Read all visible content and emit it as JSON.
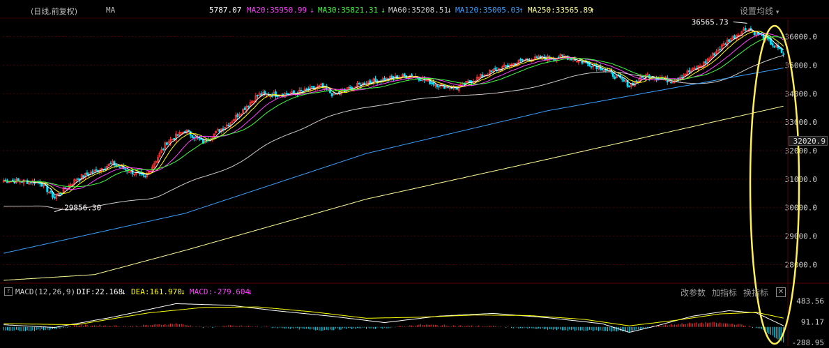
{
  "header": {
    "period_label": "(日线,前复权)",
    "ma_label": "MA",
    "ma5": "5787.07",
    "ma20": "MA20:35950.99",
    "ma30": "MA30:35821.31",
    "ma60": "MA60:35208.51",
    "ma120": "MA120:35005.03",
    "ma250": "MA250:33565.89",
    "settings_label": "设置均线",
    "arrow_down": "↓",
    "arrow_up": "↑"
  },
  "macd_header": {
    "title": "MACD(12,26,9)",
    "dif": "DIF:22.168",
    "dea": "DEA:161.970",
    "macd": "MACD:-279.604",
    "arrow_down": "↓",
    "change_params": "改参数",
    "add_indicator": "加指标",
    "switch_indicator": "换指标",
    "close": "✕",
    "help": "?"
  },
  "current_price_box": "32020.9",
  "colors": {
    "up": "#ff3333",
    "down": "#00e5ff",
    "ma5": "#ffffff",
    "ma10": "#ffff00",
    "ma20": "#ff40ff",
    "ma30": "#40ff40",
    "ma60": "#cccccc",
    "ma120": "#3aa0ff",
    "ma250": "#ffff99",
    "annotation": "#ffee55",
    "grid": "#4a0000",
    "axis_text": "#cccccc"
  },
  "chart_data": [
    {
      "type": "candlestick",
      "title": "",
      "ylim": [
        27400,
        36600
      ],
      "y_ticks": [
        "36000.0",
        "35000.0",
        "34000.0",
        "33000.0",
        "32000.0",
        "31000.0",
        "30000.0",
        "29000.0",
        "28000.0"
      ],
      "tick_values": [
        36000,
        35000,
        34000,
        33000,
        32000,
        31000,
        30000,
        29000,
        28000
      ],
      "annotations": [
        {
          "text": "29856.30",
          "value": 29856.3
        },
        {
          "text": "36565.73",
          "value": 36565.73
        }
      ],
      "close_keypoints": [
        [
          0,
          30950
        ],
        [
          20,
          30900
        ],
        [
          28,
          30350
        ],
        [
          40,
          31000
        ],
        [
          60,
          31550
        ],
        [
          78,
          31050
        ],
        [
          90,
          32300
        ],
        [
          100,
          32700
        ],
        [
          110,
          32300
        ],
        [
          125,
          33000
        ],
        [
          140,
          33950
        ],
        [
          160,
          34000
        ],
        [
          175,
          34250
        ],
        [
          182,
          33950
        ],
        [
          200,
          34400
        ],
        [
          225,
          34650
        ],
        [
          240,
          34300
        ],
        [
          250,
          34200
        ],
        [
          268,
          34750
        ],
        [
          288,
          35200
        ],
        [
          310,
          35300
        ],
        [
          330,
          34900
        ],
        [
          345,
          34300
        ],
        [
          355,
          34650
        ],
        [
          368,
          34450
        ],
        [
          385,
          35000
        ],
        [
          400,
          35900
        ],
        [
          410,
          36300
        ],
        [
          420,
          35950
        ],
        [
          430,
          35400
        ]
      ],
      "ma120_keypoints": [
        [
          0,
          28400
        ],
        [
          100,
          29800
        ],
        [
          200,
          31900
        ],
        [
          300,
          33400
        ],
        [
          430,
          34900
        ]
      ],
      "ma250_keypoints": [
        [
          0,
          27450
        ],
        [
          50,
          27650
        ],
        [
          100,
          28500
        ],
        [
          200,
          30300
        ],
        [
          300,
          31700
        ],
        [
          430,
          33560
        ]
      ]
    },
    {
      "type": "bar",
      "title": "",
      "ylim": [
        -300,
        500
      ],
      "y_ticks": [
        "483.56",
        "91.17",
        "-288.95"
      ],
      "tick_values": [
        483.56,
        91.17,
        -288.95
      ],
      "macd_keypoints": [
        [
          0,
          -60
        ],
        [
          15,
          -70
        ],
        [
          28,
          -40
        ],
        [
          40,
          30
        ],
        [
          55,
          25
        ],
        [
          70,
          10
        ],
        [
          85,
          40
        ],
        [
          95,
          60
        ],
        [
          110,
          -10
        ],
        [
          125,
          20
        ],
        [
          140,
          5
        ],
        [
          155,
          -20
        ],
        [
          175,
          -60
        ],
        [
          190,
          -30
        ],
        [
          210,
          -20
        ],
        [
          230,
          40
        ],
        [
          250,
          20
        ],
        [
          270,
          10
        ],
        [
          290,
          -30
        ],
        [
          310,
          -60
        ],
        [
          330,
          -70
        ],
        [
          345,
          -90
        ],
        [
          360,
          20
        ],
        [
          375,
          60
        ],
        [
          390,
          80
        ],
        [
          405,
          50
        ],
        [
          418,
          -40
        ],
        [
          430,
          -280
        ]
      ],
      "dif_keypoints": [
        [
          0,
          40
        ],
        [
          28,
          -10
        ],
        [
          60,
          180
        ],
        [
          95,
          430
        ],
        [
          125,
          400
        ],
        [
          150,
          300
        ],
        [
          180,
          200
        ],
        [
          210,
          80
        ],
        [
          240,
          200
        ],
        [
          270,
          250
        ],
        [
          300,
          170
        ],
        [
          330,
          60
        ],
        [
          345,
          -100
        ],
        [
          360,
          20
        ],
        [
          380,
          200
        ],
        [
          400,
          300
        ],
        [
          415,
          260
        ],
        [
          430,
          22
        ]
      ],
      "dea_keypoints": [
        [
          0,
          60
        ],
        [
          40,
          40
        ],
        [
          80,
          260
        ],
        [
          110,
          360
        ],
        [
          140,
          370
        ],
        [
          170,
          280
        ],
        [
          200,
          160
        ],
        [
          230,
          180
        ],
        [
          260,
          220
        ],
        [
          290,
          210
        ],
        [
          320,
          140
        ],
        [
          345,
          20
        ],
        [
          370,
          120
        ],
        [
          395,
          240
        ],
        [
          415,
          270
        ],
        [
          430,
          162
        ]
      ]
    }
  ]
}
